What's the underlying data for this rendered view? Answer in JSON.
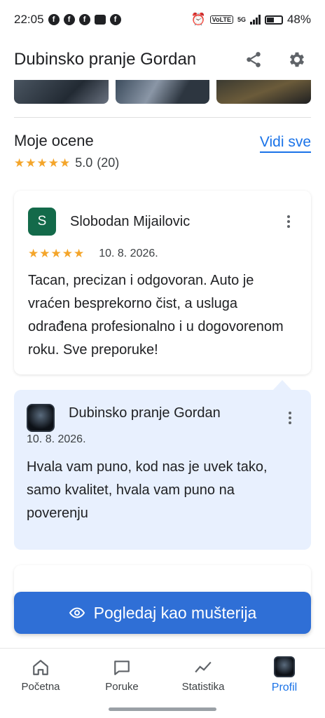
{
  "status_bar": {
    "time": "22:05",
    "battery": "48%",
    "volte": "VoLTE",
    "network": "5G"
  },
  "appbar": {
    "title": "Dubinsko pranje Gordan",
    "share_icon": "share-icon",
    "settings_icon": "gear-icon"
  },
  "ratings": {
    "title": "Moje ocene",
    "see_all": "Vidi sve",
    "stars": "★★★★★",
    "score": "5.0",
    "count": "(20)"
  },
  "review": {
    "avatar_letter": "S",
    "author": "Slobodan Mijailovic",
    "stars": "★★★★★",
    "date": "10. 8. 2026.",
    "text": "Tacan, precizan i odgovoran. Auto je vraćen besprekorno čist, a usluga odrađena profesionalno i u dogovorenom roku. Sve preporuke!"
  },
  "reply": {
    "author": "Dubinsko pranje Gordan",
    "date": "10. 8. 2026.",
    "text": "Hvala vam puno, kod nas je uvek tako, samo kvalitet, hvala vam puno na poverenju"
  },
  "cta": {
    "label": "Pogledaj kao mušterija",
    "icon": "eye-icon"
  },
  "nav": {
    "items": [
      {
        "label": "Početna",
        "icon": "home-icon"
      },
      {
        "label": "Poruke",
        "icon": "chat-icon"
      },
      {
        "label": "Statistika",
        "icon": "chart-icon"
      },
      {
        "label": "Profil",
        "icon": "profile-logo-icon"
      }
    ]
  },
  "colors": {
    "accent": "#1a73e8",
    "cta": "#2f6fd6",
    "star": "#f4a52a",
    "avatar": "#136a4a",
    "reply_bg": "#e8f0fe"
  }
}
